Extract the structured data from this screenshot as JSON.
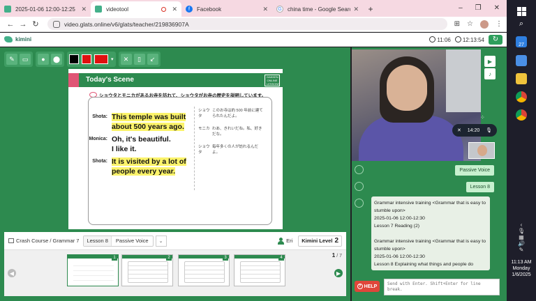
{
  "browser": {
    "tabs": [
      {
        "title": "2025-01-06 12:00-12:25",
        "active": false
      },
      {
        "title": "videotool",
        "active": true
      },
      {
        "title": "Facebook",
        "active": false
      },
      {
        "title": "china time - Google Search",
        "active": false
      }
    ],
    "new_tab": "+",
    "url": "video.glats.online/v6/glats/teacher/219836907A",
    "win_min": "–",
    "win_max": "❐",
    "win_close": "✕"
  },
  "app": {
    "logo_text": "kimini",
    "elapsed_time": "11:06",
    "clock_time": "12:13:54"
  },
  "toolbar": {
    "colors": {
      "black": "#000000",
      "red": "#e01010",
      "red_dropdown": "#e01010"
    }
  },
  "slide": {
    "title": "Today's Scene",
    "brand": "GAKKEN ONLINE LESSONS",
    "subtitle": "ショウタとモニカがあるお寺を訪れて、ショウタがお寺の歴史を説明しています。",
    "lines": [
      {
        "speaker": "Shota:",
        "text1": "This temple was built",
        "text2": "about 500 years ago.",
        "highlight": true
      },
      {
        "speaker": "Monica:",
        "text1": "Oh, it's beautiful.",
        "text2": "I like it.",
        "highlight": false
      },
      {
        "speaker": "Shota:",
        "text1": "It is visited by a lot of",
        "text2": "people every year.",
        "highlight": true
      }
    ],
    "jp_lines": [
      {
        "speaker": "ショウタ",
        "text": "このお寺は約 500 年前に建てられたんだよ。"
      },
      {
        "speaker": "モニカ",
        "text": "わあ、きれいだね。私、好きだな。"
      },
      {
        "speaker": "ショウタ",
        "text": "毎年多くの人が訪れるんだよ。"
      }
    ]
  },
  "lesson_info": {
    "course": "Crash Course / Grammar 7",
    "lesson_number": "Lesson 8",
    "lesson_name": "Passive Voice",
    "student_name": "Eri",
    "level_label": "Kimini Level",
    "level_value": "2"
  },
  "thumbnails": {
    "current_page": "1",
    "total_pages": "7",
    "items": [
      {
        "num": "1",
        "selected": true
      },
      {
        "num": "2",
        "selected": false
      },
      {
        "num": "3",
        "selected": false
      },
      {
        "num": "4",
        "selected": false
      }
    ]
  },
  "video": {
    "call_time": "14:20"
  },
  "chat": {
    "chips": [
      "Passive Voice",
      "Lesson 8"
    ],
    "message_lines": [
      "Grammar intensive training <Grammar that is easy to stumble upon>",
      "2025-01-06 12:00-12:30",
      "Lesson 7 Reading (2)",
      "",
      "Grammar intensive training <Grammar that is easy to stumble upon>",
      "2025-01-06 12:00-12:30",
      "Lesson 8 Explaining what things and people do"
    ],
    "help_label": "HELP",
    "input_placeholder": "Send with Enter. Shift+Enter for line break."
  },
  "taskbar": {
    "calendar_day": "27",
    "time": "11:13 AM",
    "weekday": "Monday",
    "date": "1/6/2025"
  }
}
